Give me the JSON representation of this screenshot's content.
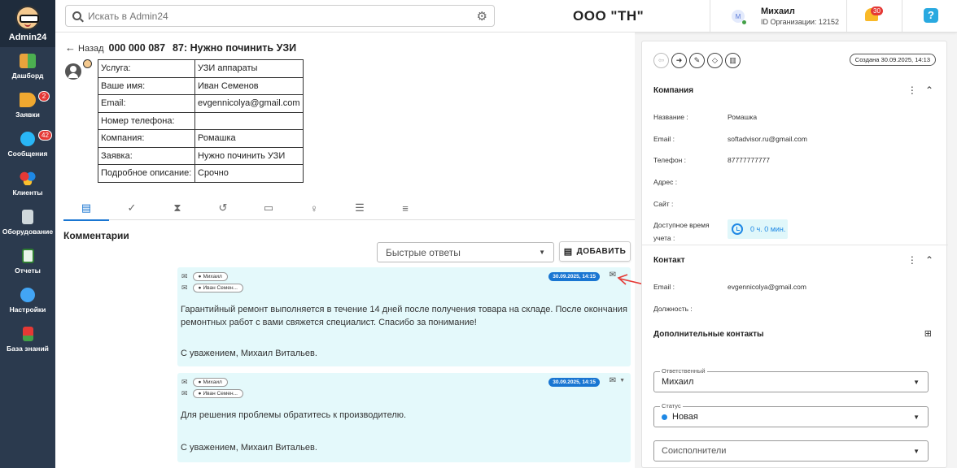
{
  "app": {
    "name": "Admin24"
  },
  "sidebar": {
    "items": [
      {
        "label": "Дашборд",
        "badge": ""
      },
      {
        "label": "Заявки",
        "badge": "2"
      },
      {
        "label": "Сообщения",
        "badge": "42"
      },
      {
        "label": "Клиенты",
        "badge": ""
      },
      {
        "label": "Оборудование",
        "badge": ""
      },
      {
        "label": "Отчеты",
        "badge": ""
      },
      {
        "label": "Настройки",
        "badge": ""
      },
      {
        "label": "База знаний",
        "badge": ""
      }
    ]
  },
  "topbar": {
    "search_placeholder": "Искать в Admin24",
    "company": "ООО \"ТН\"",
    "user_initial": "М",
    "user_name": "Михаил",
    "org_id": "ID Организации: 12152",
    "notifications": "30",
    "help": "?"
  },
  "ticket": {
    "back_label": "Назад",
    "number": "000 000 087",
    "title": "87: Нужно починить УЗИ",
    "fields": [
      {
        "key": "Услуга:",
        "value": "УЗИ аппараты"
      },
      {
        "key": "Ваше имя:",
        "value": "Иван Семенов"
      },
      {
        "key": "Email:",
        "value": "evgennicolya@gmail.com"
      },
      {
        "key": "Номер телефона:",
        "value": ""
      },
      {
        "key": "Компания:",
        "value": "Ромашка"
      },
      {
        "key": "Заявка:",
        "value": "Нужно починить УЗИ"
      },
      {
        "key": "Подробное описание:",
        "value": "Срочно"
      }
    ]
  },
  "comments_section": {
    "title": "Комментарии",
    "quick_replies": "Быстрые ответы",
    "add_button": "ДОБАВИТЬ",
    "items": [
      {
        "author": "Михаил",
        "recipient": "Иван Семен...",
        "date": "30.09.2025, 14:15",
        "text1": "Гарантийный ремонт выполняется в течение 14 дней после получения товара на складе. После окончания",
        "text2": "ремонтных работ с вами свяжется специалист. Спасибо за понимание!",
        "signature": "С уважением, Михаил Витальев."
      },
      {
        "author": "Михаил",
        "recipient": "Иван Семен...",
        "date": "30.09.2025, 14:15",
        "text1": "Для решения проблемы обратитесь к производителю.",
        "signature": "С уважением, Михаил Витальев."
      }
    ]
  },
  "right_panel": {
    "created": "Создана 30.09.2025, 14:13",
    "company": {
      "title": "Компания",
      "name_label": "Название :",
      "name_value": "Ромашка",
      "email_label": "Email :",
      "email_value": "softadvisor.ru@gmail.com",
      "phone_label": "Телефон :",
      "phone_value": "87777777777",
      "address_label": "Адрес :",
      "site_label": "Сайт :",
      "time_label_1": "Доступное время",
      "time_label_2": "учета :",
      "time_value": "0 ч. 0 мин."
    },
    "contact": {
      "title": "Контакт",
      "email_label": "Email :",
      "email_value": "evgennicolya@gmail.com",
      "position_label": "Должность :"
    },
    "extra_contacts": {
      "title": "Дополнительные контакты"
    },
    "responsible": {
      "legend": "Ответственный",
      "value": "Михаил"
    },
    "status": {
      "legend": "Статус",
      "value": "Новая"
    },
    "coexecutors": {
      "placeholder": "Соисполнители"
    }
  },
  "colors": {
    "accent": "#1976d2",
    "sidebar": "#2b3a4e",
    "comment_bg": "#e4f9fb",
    "arrow": "#e53935"
  }
}
